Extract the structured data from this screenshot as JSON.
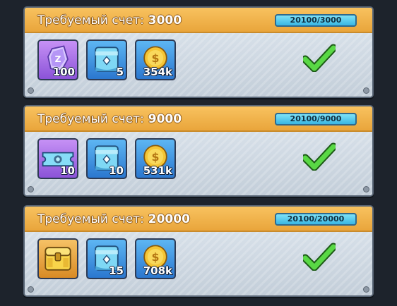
{
  "rewards": [
    {
      "label": "Требуемый счет:",
      "required": "3000",
      "progress": "20100/3000",
      "completed": true,
      "items": [
        {
          "icon": "purple-crystal-shard-icon",
          "qty": "100",
          "frame": "purple"
        },
        {
          "icon": "blue-card-pack-icon",
          "qty": "5",
          "frame": "blue"
        },
        {
          "icon": "gold-coin-icon",
          "qty": "354k",
          "frame": "blue"
        }
      ]
    },
    {
      "label": "Требуемый счет:",
      "required": "9000",
      "progress": "20100/9000",
      "completed": true,
      "items": [
        {
          "icon": "blue-ticket-icon",
          "qty": "10",
          "frame": "purple"
        },
        {
          "icon": "blue-card-pack-icon",
          "qty": "10",
          "frame": "blue"
        },
        {
          "icon": "gold-coin-icon",
          "qty": "531k",
          "frame": "blue"
        }
      ]
    },
    {
      "label": "Требуемый счет:",
      "required": "20000",
      "progress": "20100/20000",
      "completed": true,
      "items": [
        {
          "icon": "gold-chest-icon",
          "qty": "",
          "frame": "gold"
        },
        {
          "icon": "blue-card-pack-icon",
          "qty": "15",
          "frame": "blue"
        },
        {
          "icon": "gold-coin-icon",
          "qty": "708k",
          "frame": "blue"
        }
      ]
    }
  ],
  "colors": {
    "header": "#f1b24b",
    "badge": "#4fc6ec",
    "check": "#4fd33f",
    "purple_frame": "#9c62e2",
    "blue_frame": "#3b8fe0"
  }
}
